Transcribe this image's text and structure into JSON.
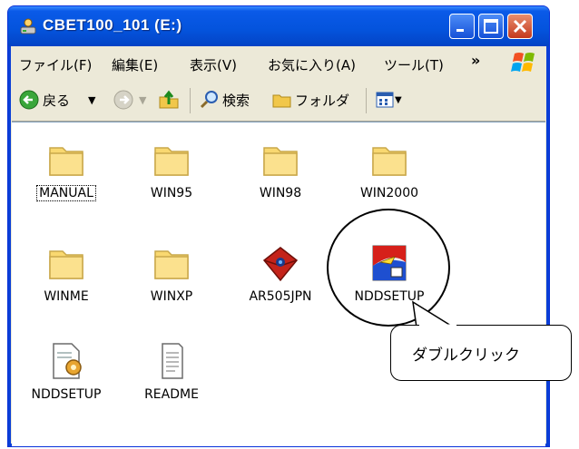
{
  "window": {
    "title": "CBET100_101 (E:)"
  },
  "menu": {
    "file": "ファイル(F)",
    "edit": "編集(E)",
    "view": "表示(V)",
    "favorites": "お気に入り(A)",
    "tools": "ツール(T)",
    "more": "»"
  },
  "toolbar": {
    "back": "戻る",
    "search": "検索",
    "folders": "フォルダ"
  },
  "files": [
    {
      "name": "MANUAL",
      "icon": "folder-icon"
    },
    {
      "name": "WIN95",
      "icon": "folder-icon"
    },
    {
      "name": "WIN98",
      "icon": "folder-icon"
    },
    {
      "name": "WIN2000",
      "icon": "folder-icon"
    },
    {
      "name": "WINME",
      "icon": "folder-icon"
    },
    {
      "name": "WINXP",
      "icon": "folder-icon"
    },
    {
      "name": "AR505JPN",
      "icon": "package-icon"
    },
    {
      "name": "NDDSETUP",
      "icon": "setup-exe-icon"
    },
    {
      "name": "NDDSETUP",
      "icon": "config-file-icon"
    },
    {
      "name": "README",
      "icon": "text-file-icon"
    }
  ],
  "callout": {
    "text": "ダブルクリック"
  },
  "colors": {
    "titlebar": "#0453dc",
    "folder": "#f9d870",
    "window_bg": "#ece9d8",
    "close_button": "#c4391d"
  }
}
